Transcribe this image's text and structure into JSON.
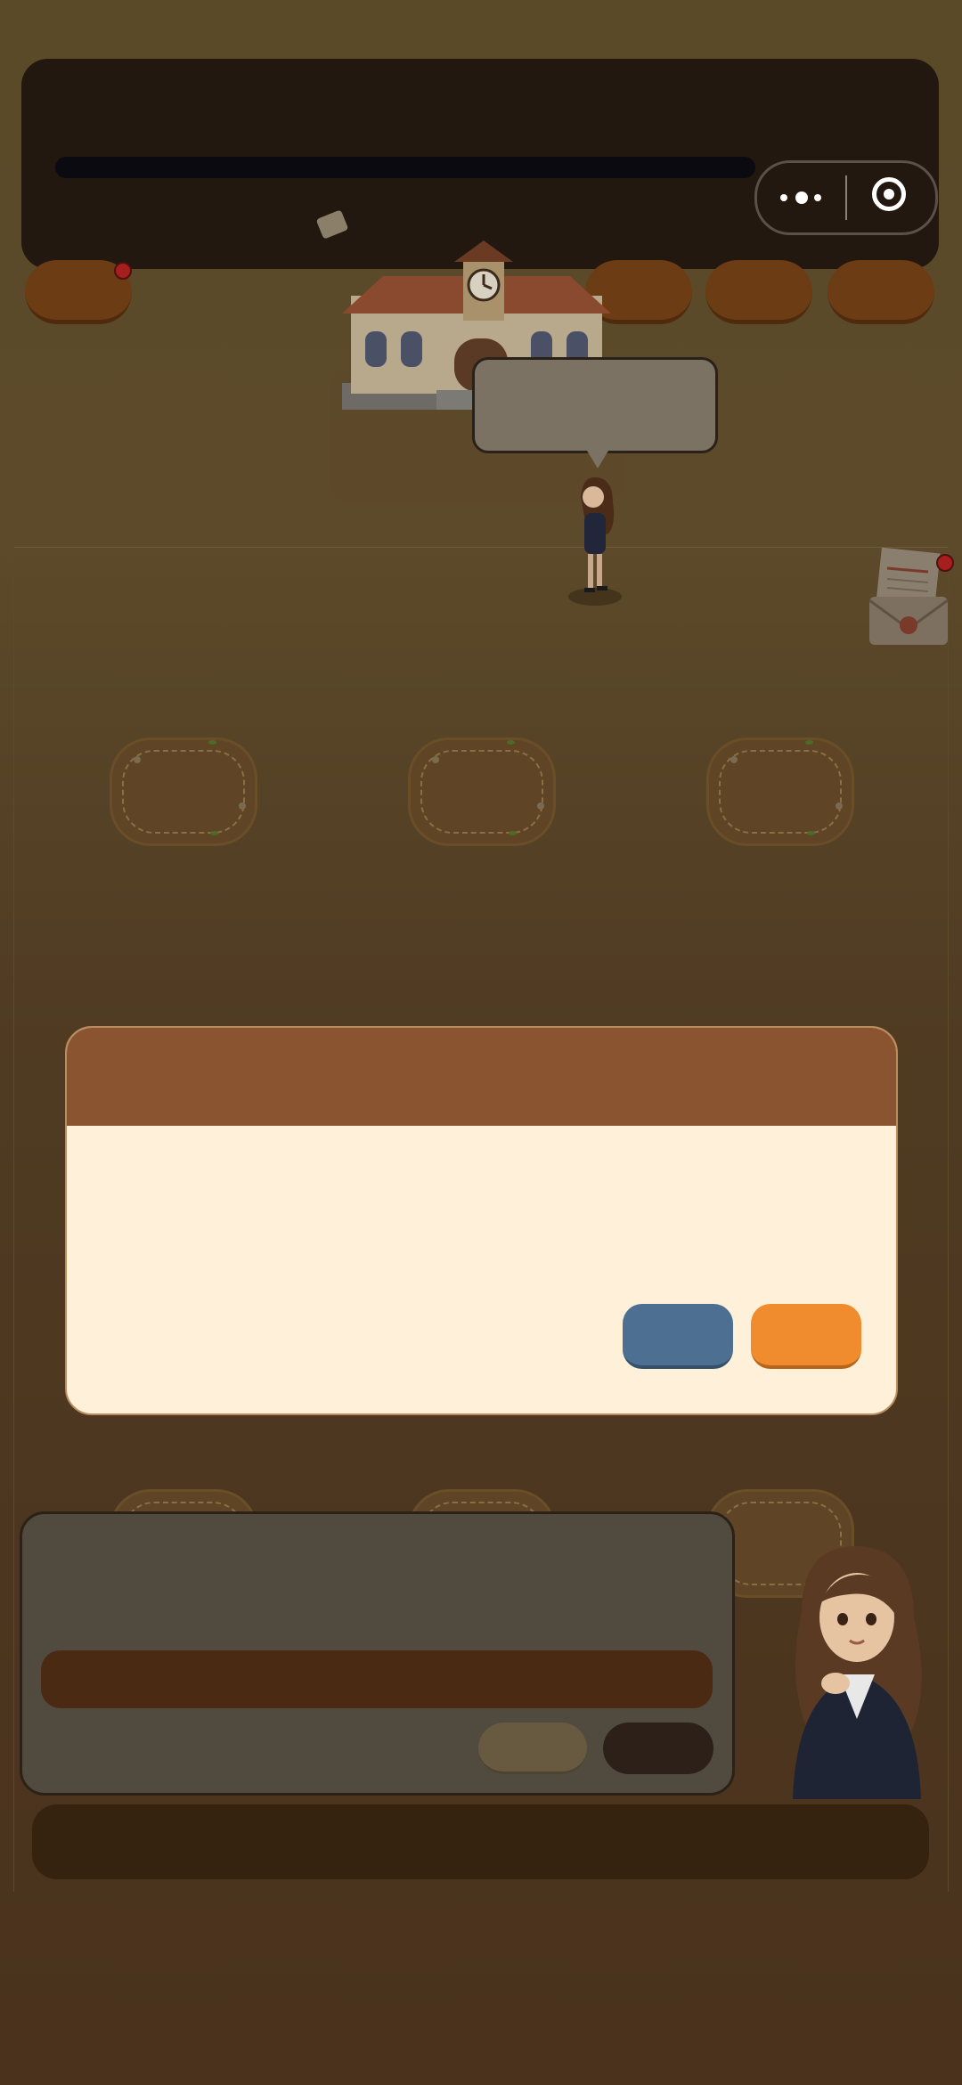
{
  "hud": {
    "menu_icon": "more-dots-icon",
    "close_icon": "target-circle-icon",
    "notification_color": "#a71e1e"
  },
  "scene": {
    "building": "town-hall-clock-building",
    "characters": [
      "secretary-girl"
    ],
    "notice": "Notice Board",
    "plots_count": 6
  },
  "dialog": {
    "header_color": "#8a5430",
    "body_color": "#fff1d9",
    "cancel_color": "#4d6f92",
    "confirm_color": "#f08c2e"
  },
  "narration": {
    "panel_color": "#514a3e",
    "bar_color": "#4a2a12"
  }
}
